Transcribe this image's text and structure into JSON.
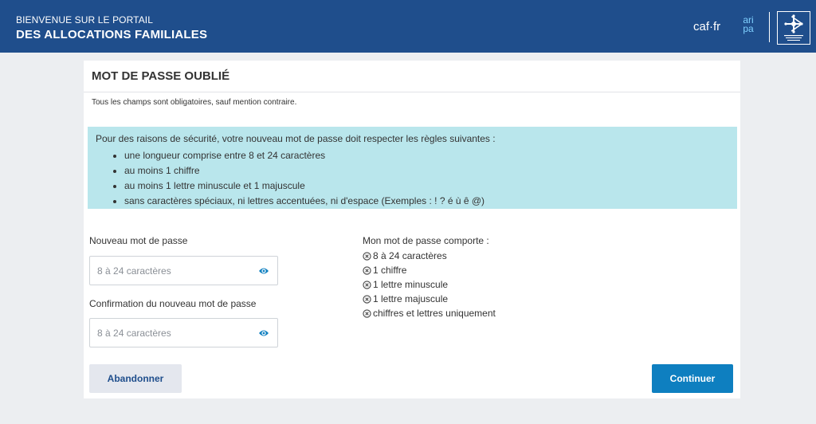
{
  "header": {
    "line1": "BIENVENUE SUR LE PORTAIL",
    "line2": "DES ALLOCATIONS FAMILIALES",
    "caf_logo": "caf·fr",
    "aripa_logo_top": "ari",
    "aripa_logo_bottom": "pa",
    "badge_icon": "allocations-familiales-logo-icon"
  },
  "card": {
    "title": "MOT DE PASSE OUBLIÉ",
    "required_note": "Tous les champs sont obligatoires, sauf mention contraire."
  },
  "info": {
    "intro": "Pour des raisons de sécurité, votre nouveau mot de passe doit respecter les règles suivantes :",
    "rules": [
      "une longueur comprise entre 8 et 24 caractères",
      "au moins 1 chiffre",
      "au moins 1 lettre minuscule et 1 majuscule",
      "sans caractères spéciaux, ni lettres accentuées, ni d'espace (Exemples : ! ? é ù ê @)"
    ]
  },
  "form": {
    "new_password_label": "Nouveau mot de passe",
    "new_password_placeholder": "8 à 24 caractères",
    "new_password_value": "",
    "confirm_password_label": "Confirmation du nouveau mot de passe",
    "confirm_password_placeholder": "8 à 24 caractères",
    "confirm_password_value": "",
    "eye_icon": "eye-icon"
  },
  "checklist": {
    "title": "Mon mot de passe comporte :",
    "icon": "circle-x-icon",
    "items": [
      "8 à 24 caractères",
      "1 chiffre",
      "1 lettre minuscule",
      "1 lettre majuscule",
      "chiffres et lettres uniquement"
    ]
  },
  "buttons": {
    "cancel": "Abandonner",
    "continue": "Continuer"
  },
  "colors": {
    "header_bg": "#1f4e8c",
    "info_bg": "#b9e6ec",
    "primary_button": "#0e7fc0",
    "eye_icon": "#0e7fc0"
  }
}
